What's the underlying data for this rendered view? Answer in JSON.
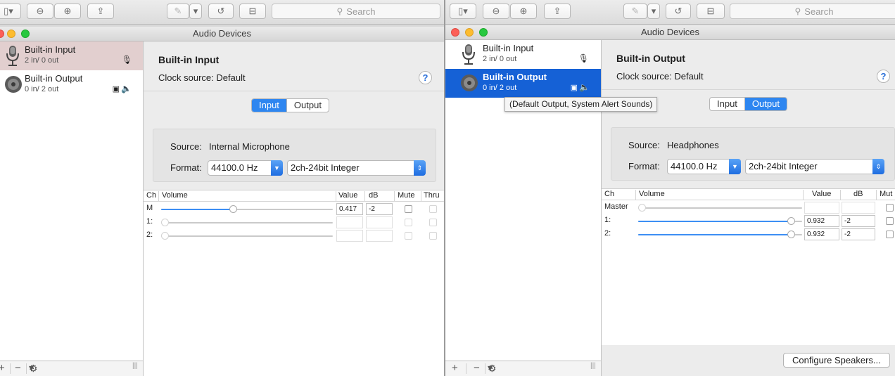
{
  "toolbar": {
    "search_placeholder": "Search"
  },
  "left_window": {
    "title": "Audio Devices",
    "devices": [
      {
        "name": "Built-in Input",
        "io": "2 in/ 0 out"
      },
      {
        "name": "Built-in Output",
        "io": "0 in/ 2 out"
      }
    ],
    "detail": {
      "device_title": "Built-in Input",
      "clock_label": "Clock source:",
      "clock_value": "Default",
      "help": "?",
      "tabs": [
        "Input",
        "Output"
      ],
      "active_tab": "Input",
      "source_label": "Source:",
      "source_value": "Internal Microphone",
      "format_label": "Format:",
      "sample_rate": "44100.0 Hz",
      "bit_format": "2ch-24bit Integer",
      "table": {
        "headers": [
          "Ch",
          "Volume",
          "Value",
          "dB",
          "Mute",
          "Thru"
        ],
        "rows": [
          {
            "ch": "M",
            "level": 0.417,
            "value": "0.417",
            "db": "-2"
          },
          {
            "ch": "1:",
            "level": 0,
            "value": "",
            "db": ""
          },
          {
            "ch": "2:",
            "level": 0,
            "value": "",
            "db": ""
          }
        ]
      }
    },
    "bottom_bar": {
      "add": "+",
      "remove": "−",
      "gear": "⚙"
    }
  },
  "right_window": {
    "title": "Audio Devices",
    "devices": [
      {
        "name": "Built-in Input",
        "io": "2 in/ 0 out"
      },
      {
        "name": "Built-in Output",
        "io": "0 in/ 2 out"
      }
    ],
    "tooltip": "(Default Output, System Alert Sounds)",
    "detail": {
      "device_title": "Built-in Output",
      "clock_label": "Clock source:",
      "clock_value": "Default",
      "help": "?",
      "tabs": [
        "Input",
        "Output"
      ],
      "active_tab": "Output",
      "source_label": "Source:",
      "source_value": "Headphones",
      "format_label": "Format:",
      "sample_rate": "44100.0 Hz",
      "bit_format": "2ch-24bit Integer",
      "table": {
        "headers": [
          "Ch",
          "Volume",
          "Value",
          "dB",
          "Mut"
        ],
        "rows": [
          {
            "ch": "Master",
            "level": 0,
            "value": "",
            "db": ""
          },
          {
            "ch": "1:",
            "level": 0.932,
            "value": "0.932",
            "db": "-2"
          },
          {
            "ch": "2:",
            "level": 0.932,
            "value": "0.932",
            "db": "-2"
          }
        ]
      }
    },
    "configure_button": "Configure Speakers...",
    "bottom_bar": {
      "add": "+",
      "remove": "−",
      "gear": "⚙"
    }
  },
  "colors": {
    "accent": "#2e86f0",
    "selection_active": "#1561d6",
    "selection_inactive": "#e2cfcf"
  }
}
